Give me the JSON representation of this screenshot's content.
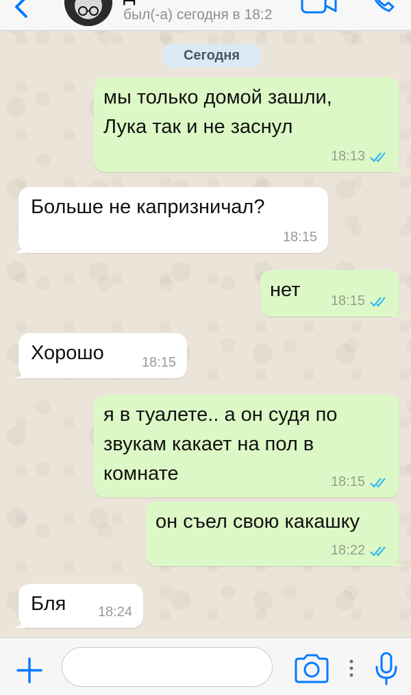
{
  "header": {
    "contact_name": "Д",
    "last_seen": "был(-а) сегодня в 18:2"
  },
  "chat": {
    "date_label": "Сегодня",
    "messages": [
      {
        "direction": "out",
        "text": "мы только домой зашли,\nЛука так и не заснул",
        "time": "18:13",
        "read": true
      },
      {
        "direction": "in",
        "text": "Больше не капризничал?",
        "time": "18:15"
      },
      {
        "direction": "out",
        "text": "нет",
        "time": "18:15",
        "read": true
      },
      {
        "direction": "in",
        "text": "Хорошо",
        "time": "18:15"
      },
      {
        "direction": "out",
        "text": "я в туалете.. а он судя по\nзвукам какает на пол в\nкомнате",
        "time": "18:15",
        "read": true
      },
      {
        "direction": "out",
        "text": "он съел свою какашку",
        "time": "18:22",
        "read": true
      },
      {
        "direction": "in",
        "text": "Бля",
        "time": "18:24"
      }
    ]
  },
  "input_bar": {
    "message_value": "",
    "message_placeholder": ""
  },
  "colors": {
    "accent": "#007aff",
    "outgoing_bubble": "#dcf8c6",
    "incoming_bubble": "#ffffff",
    "read_ticks": "#34b7f1",
    "date_pill": "#dce8f4"
  },
  "icons": [
    "back-chevron-icon",
    "avatar",
    "video-call-icon",
    "phone-call-icon",
    "plus-icon",
    "camera-icon",
    "more-dots-icon",
    "microphone-icon",
    "double-check-icon"
  ]
}
